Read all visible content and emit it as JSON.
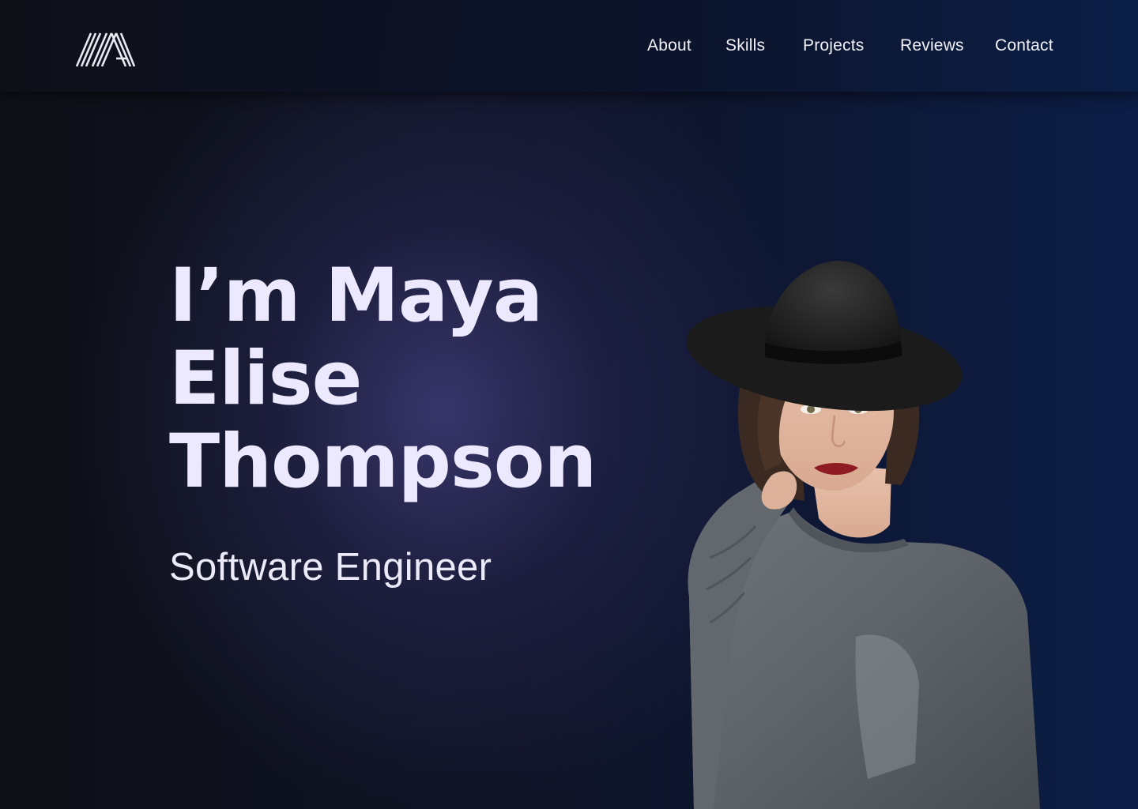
{
  "nav": {
    "logo_icon": "striped-m-logo-icon",
    "links": [
      {
        "label": "About"
      },
      {
        "label": "Skills"
      },
      {
        "label": "Projects"
      },
      {
        "label": "Reviews"
      },
      {
        "label": "Contact"
      }
    ]
  },
  "hero": {
    "title_lines": [
      "I’m Maya",
      "Elise",
      "Thompson"
    ],
    "subtitle": "Software Engineer",
    "portrait_icon": "portrait-photo-icon"
  },
  "colors": {
    "background_left": "#0e1017",
    "background_right": "#0c1d46",
    "glow": "#3a376e",
    "title": "#ece9ff",
    "text": "#f2f2f8"
  }
}
